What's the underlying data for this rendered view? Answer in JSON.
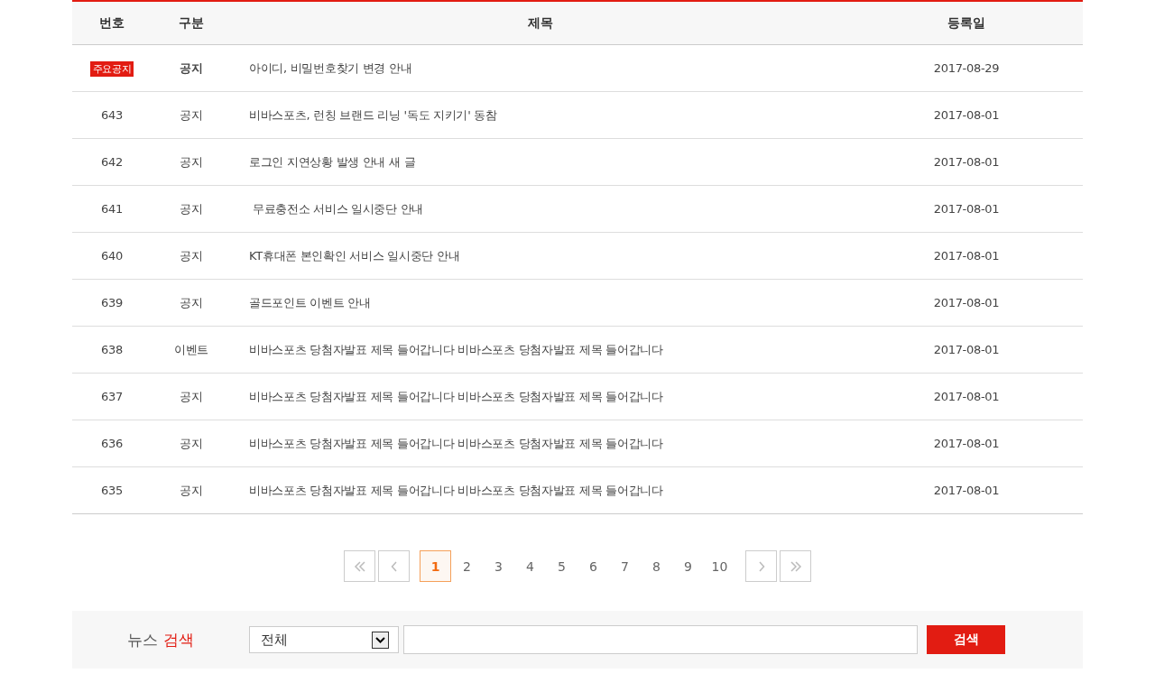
{
  "table": {
    "columns": [
      "번호",
      "구분",
      "제목",
      "등록일"
    ],
    "rows": [
      {
        "number": "주요공지",
        "important": true,
        "category": "공지",
        "title": "아이디, 비밀번호찾기 변경 안내",
        "date": "2017-08-29"
      },
      {
        "number": "643",
        "important": false,
        "category": "공지",
        "title": "비바스포츠, 런칭 브랜드 리닝 '독도 지키기' 동참",
        "date": "2017-08-01"
      },
      {
        "number": "642",
        "important": false,
        "category": "공지",
        "title": "로그인 지연상황 발생 안내 새 글",
        "date": "2017-08-01"
      },
      {
        "number": "641",
        "important": false,
        "category": "공지",
        "title": " 무료충전소 서비스 일시중단 안내",
        "date": "2017-08-01"
      },
      {
        "number": "640",
        "important": false,
        "category": "공지",
        "title": "KT휴대폰 본인확인 서비스 일시중단 안내",
        "date": "2017-08-01"
      },
      {
        "number": "639",
        "important": false,
        "category": "공지",
        "title": "골드포인트 이벤트 안내",
        "date": "2017-08-01"
      },
      {
        "number": "638",
        "important": false,
        "category": "이벤트",
        "title": "비바스포츠 당첨자발표 제목 들어갑니다 비바스포츠 당첨자발표 제목 들어갑니다",
        "date": "2017-08-01"
      },
      {
        "number": "637",
        "important": false,
        "category": "공지",
        "title": "비바스포츠 당첨자발표 제목 들어갑니다 비바스포츠 당첨자발표 제목 들어갑니다",
        "date": "2017-08-01"
      },
      {
        "number": "636",
        "important": false,
        "category": "공지",
        "title": "비바스포츠 당첨자발표 제목 들어갑니다 비바스포츠 당첨자발표 제목 들어갑니다",
        "date": "2017-08-01"
      },
      {
        "number": "635",
        "important": false,
        "category": "공지",
        "title": "비바스포츠 당첨자발표 제목 들어갑니다 비바스포츠 당첨자발표 제목 들어갑니다",
        "date": "2017-08-01"
      }
    ]
  },
  "pagination": {
    "pages": [
      {
        "label": "1",
        "selected": true
      },
      {
        "label": "2",
        "selected": false
      },
      {
        "label": "3",
        "selected": false
      },
      {
        "label": "4",
        "selected": false
      },
      {
        "label": "5",
        "selected": false
      },
      {
        "label": "6",
        "selected": false
      },
      {
        "label": "7",
        "selected": false
      },
      {
        "label": "8",
        "selected": false
      },
      {
        "label": "9",
        "selected": false
      },
      {
        "label": "10",
        "selected": false
      }
    ]
  },
  "search": {
    "label": "뉴스",
    "label_accent": "검색",
    "scope": "전체",
    "button": "검색"
  }
}
